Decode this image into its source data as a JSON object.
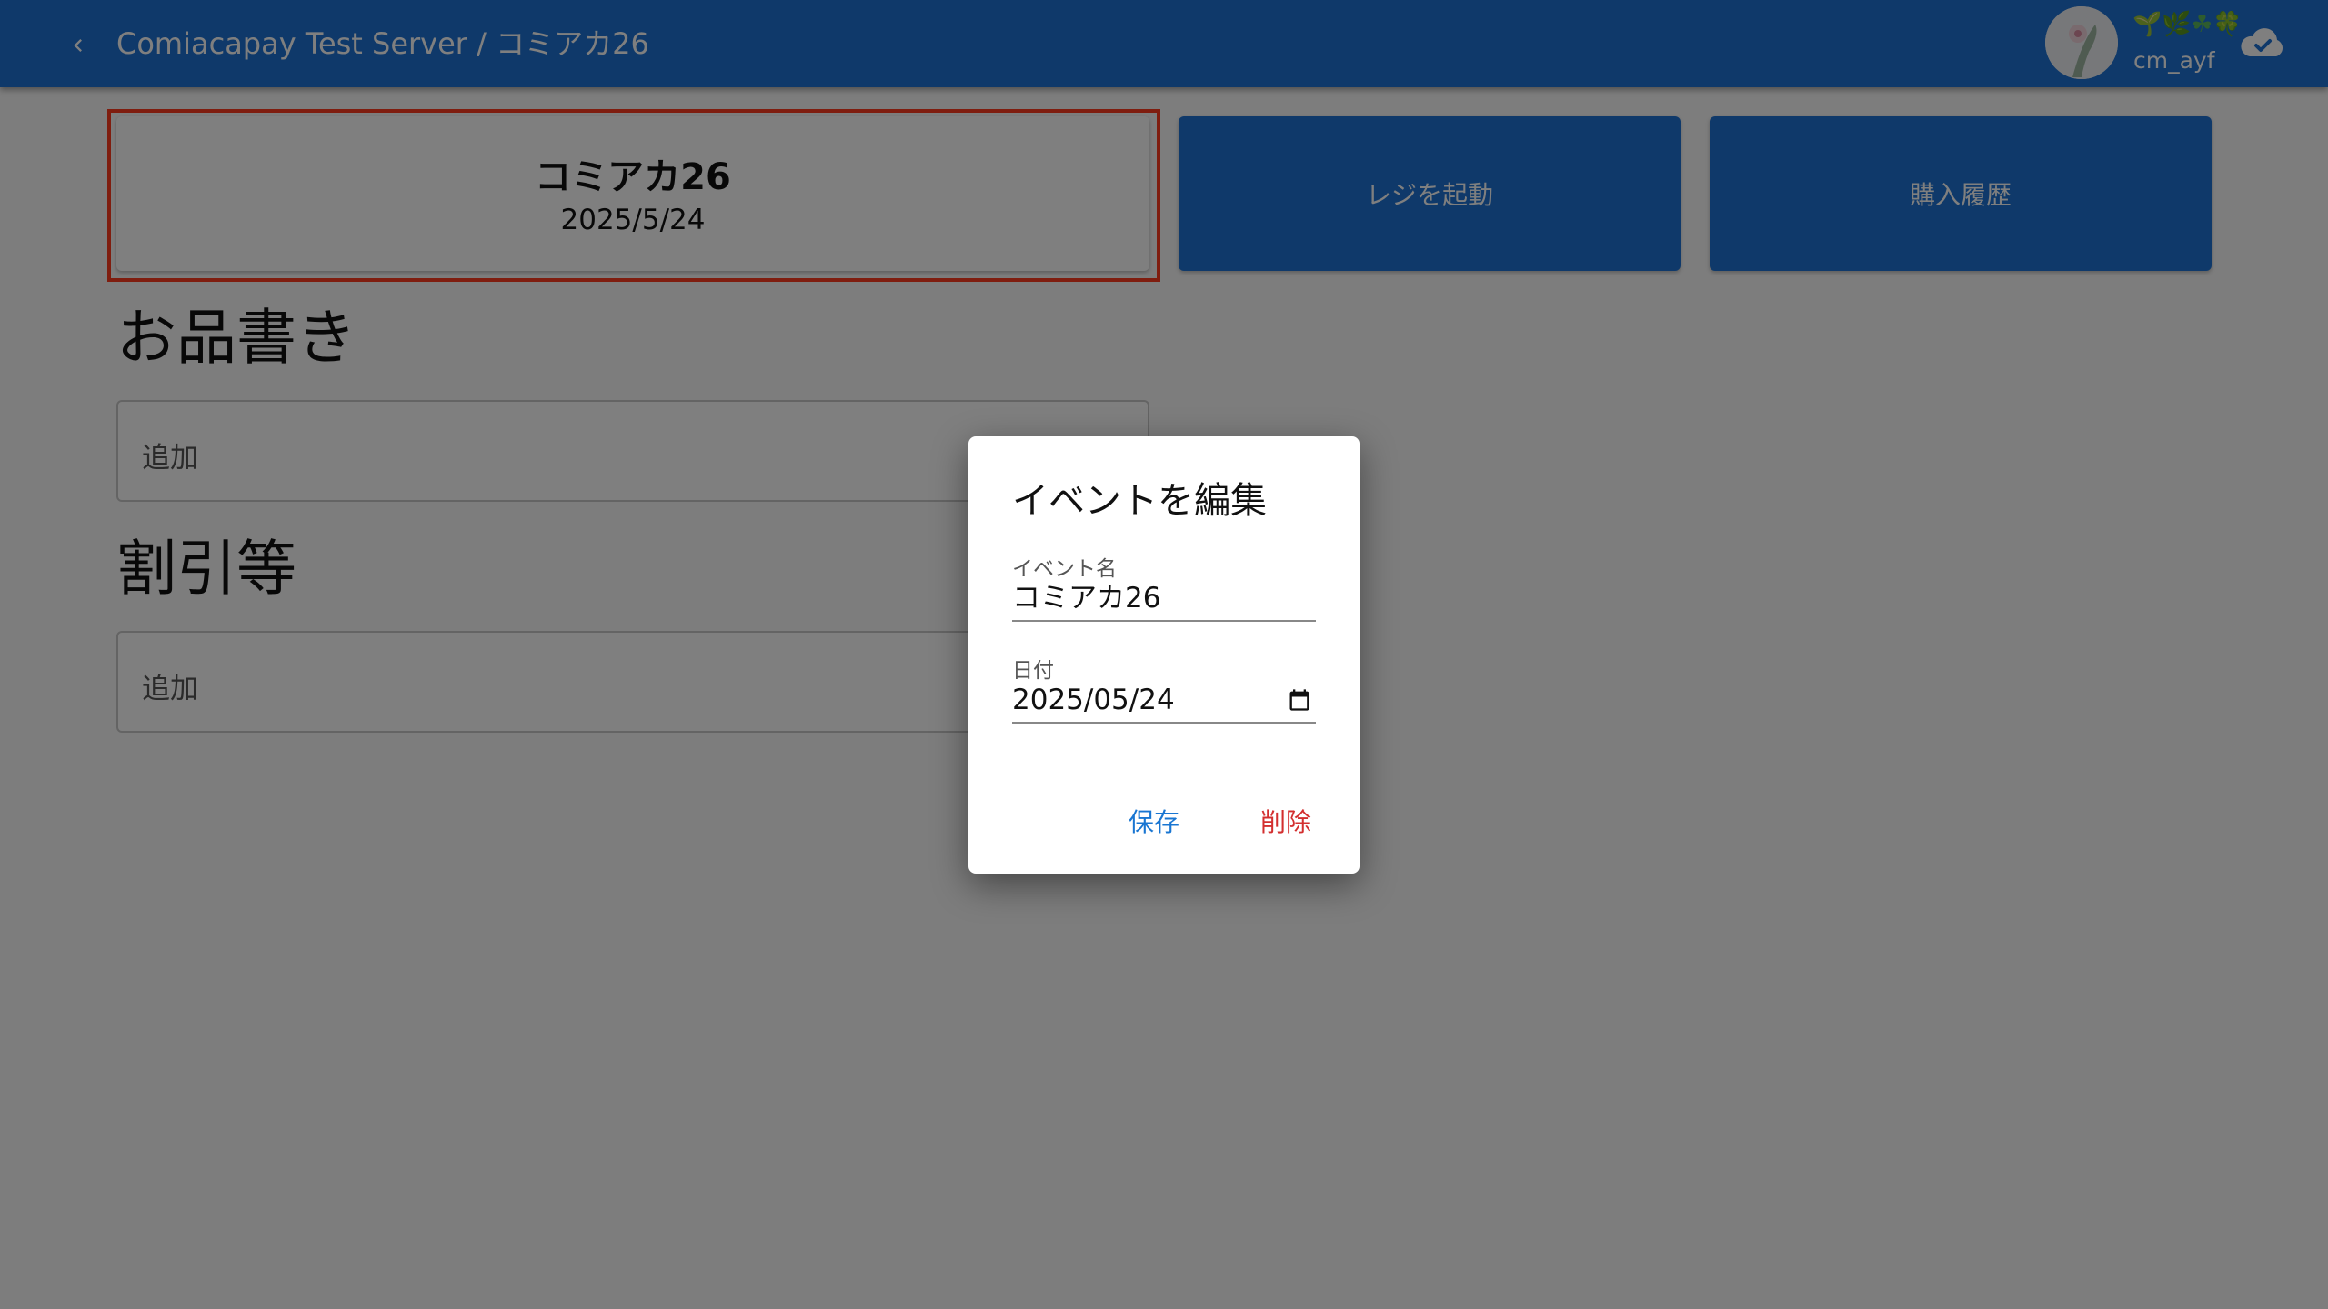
{
  "header": {
    "title": "Comiacapay Test Server / コミアカ26",
    "back_icon": "chevron-left-icon",
    "user": {
      "emoji": "🌱🌿☘🍀",
      "name": "cm_ayf"
    },
    "sync_icon": "cloud-check-icon"
  },
  "event_card": {
    "name": "コミアカ26",
    "date": "2025/5/24"
  },
  "actions": {
    "register": "レジを起動",
    "history": "購入履歴"
  },
  "sections": {
    "menu": {
      "heading": "お品書き",
      "add_label": "追加"
    },
    "discount": {
      "heading": "割引等",
      "add_label": "追加"
    }
  },
  "dialog": {
    "title": "イベントを編集",
    "name_label": "イベント名",
    "name_value": "コミアカ26",
    "date_label": "日付",
    "date_value": "2025/05/24",
    "save": "保存",
    "delete": "削除"
  },
  "colors": {
    "primary": "#1e73d4",
    "highlight": "#ff3b1f",
    "save": "#1976d2",
    "delete": "#d32f2f"
  }
}
